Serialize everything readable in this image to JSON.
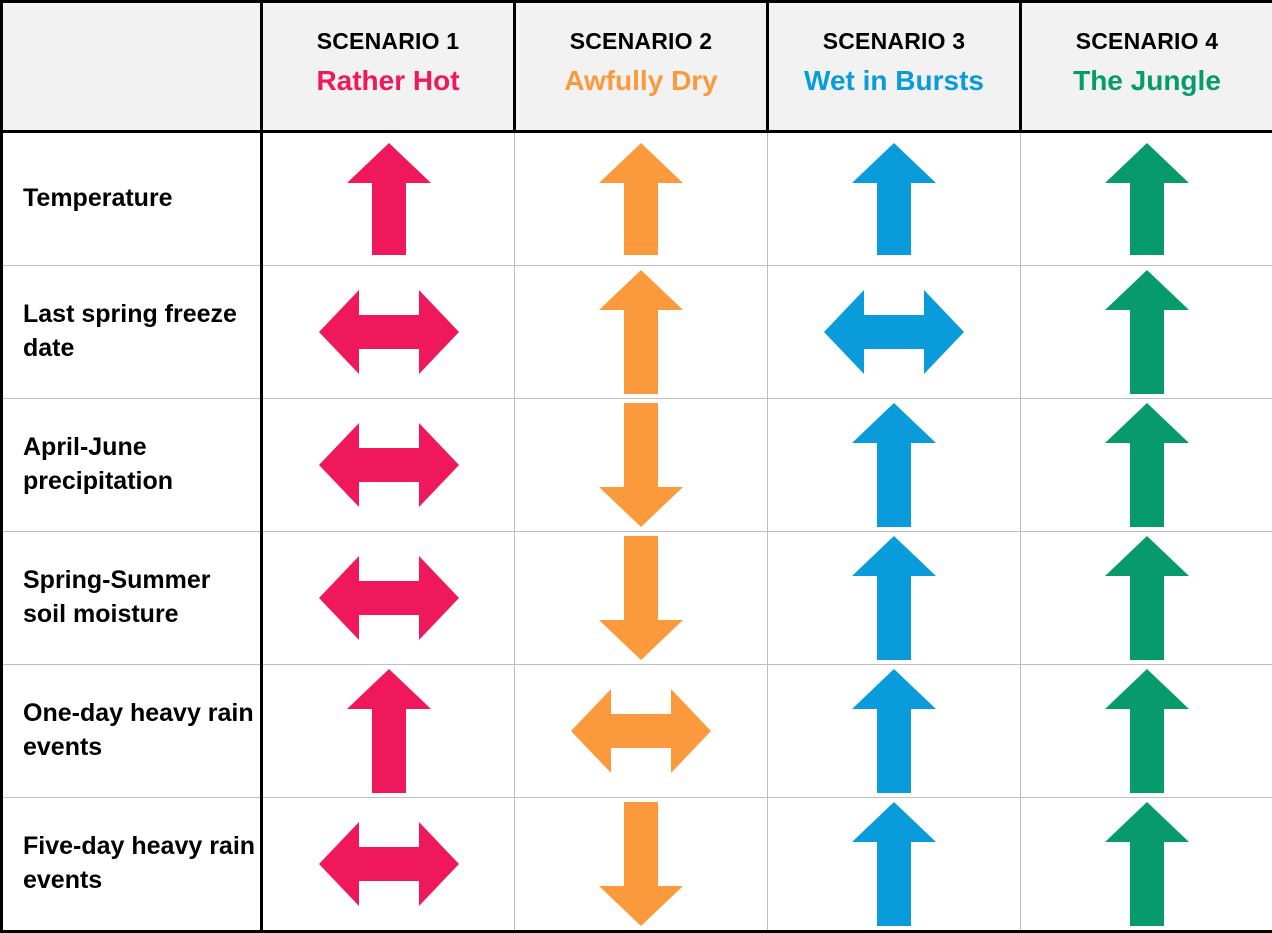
{
  "table": {
    "corner_label": "",
    "columns": [
      {
        "number": "SCENARIO 1",
        "name": "Rather Hot",
        "color": "#F0185C"
      },
      {
        "number": "SCENARIO 2",
        "name": "Awfully Dry",
        "color": "#FB9A3C"
      },
      {
        "number": "SCENARIO 3",
        "name": "Wet in Bursts",
        "color": "#0A9BDB"
      },
      {
        "number": "SCENARIO 4",
        "name": "The Jungle",
        "color": "#079B6C"
      }
    ],
    "rows": [
      {
        "label": "Temperature",
        "cells": [
          {
            "direction": "up",
            "icon": "arrow-up-icon",
            "size": "medium"
          },
          {
            "direction": "up",
            "icon": "arrow-up-icon",
            "size": "medium"
          },
          {
            "direction": "up",
            "icon": "arrow-up-icon",
            "size": "medium"
          },
          {
            "direction": "up",
            "icon": "arrow-up-icon",
            "size": "medium"
          }
        ]
      },
      {
        "label": "Last spring freeze date",
        "cells": [
          {
            "direction": "horizontal",
            "icon": "arrow-left-right-icon",
            "size": "medium"
          },
          {
            "direction": "up",
            "icon": "arrow-up-icon",
            "size": "tall"
          },
          {
            "direction": "horizontal",
            "icon": "arrow-left-right-icon",
            "size": "medium"
          },
          {
            "direction": "up",
            "icon": "arrow-up-icon",
            "size": "tall"
          }
        ]
      },
      {
        "label": "April-June precipitation",
        "cells": [
          {
            "direction": "horizontal",
            "icon": "arrow-left-right-icon",
            "size": "medium"
          },
          {
            "direction": "down",
            "icon": "arrow-down-icon",
            "size": "tall"
          },
          {
            "direction": "up",
            "icon": "arrow-up-icon",
            "size": "tall"
          },
          {
            "direction": "up",
            "icon": "arrow-up-icon",
            "size": "tall"
          }
        ]
      },
      {
        "label": "Spring-Summer soil moisture",
        "cells": [
          {
            "direction": "horizontal",
            "icon": "arrow-left-right-icon",
            "size": "medium"
          },
          {
            "direction": "down",
            "icon": "arrow-down-icon",
            "size": "tall"
          },
          {
            "direction": "up",
            "icon": "arrow-up-icon",
            "size": "tall"
          },
          {
            "direction": "up",
            "icon": "arrow-up-icon",
            "size": "tall"
          }
        ]
      },
      {
        "label": "One-day heavy rain events",
        "cells": [
          {
            "direction": "up",
            "icon": "arrow-up-icon",
            "size": "tall"
          },
          {
            "direction": "horizontal",
            "icon": "arrow-left-right-icon",
            "size": "medium"
          },
          {
            "direction": "up",
            "icon": "arrow-up-icon",
            "size": "tall"
          },
          {
            "direction": "up",
            "icon": "arrow-up-icon",
            "size": "tall"
          }
        ]
      },
      {
        "label": "Five-day heavy rain events",
        "cells": [
          {
            "direction": "horizontal",
            "icon": "arrow-left-right-icon",
            "size": "medium"
          },
          {
            "direction": "down",
            "icon": "arrow-down-icon",
            "size": "tall"
          },
          {
            "direction": "up",
            "icon": "arrow-up-icon",
            "size": "tall"
          },
          {
            "direction": "up",
            "icon": "arrow-up-icon",
            "size": "tall"
          }
        ]
      }
    ]
  },
  "style": {
    "header_background": "#F2F2F2",
    "body_background": "#FFFFFF",
    "outer_border_color": "#000000",
    "inner_grid_color": "#BFBFBF",
    "text_color": "#000000"
  }
}
